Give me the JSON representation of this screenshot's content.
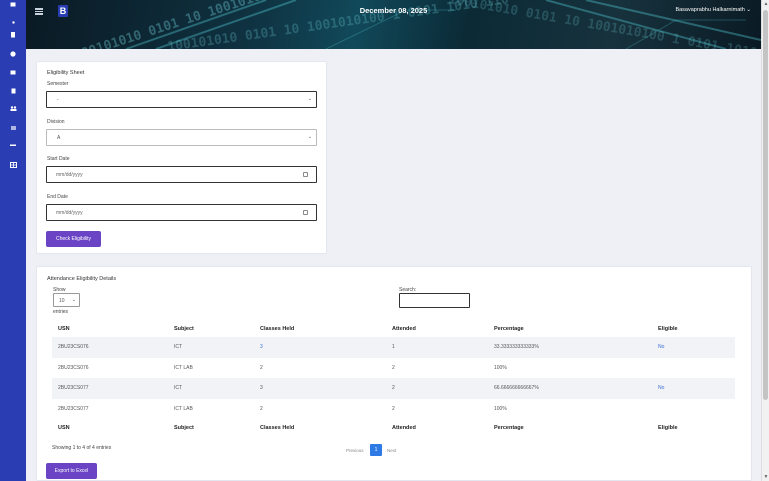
{
  "header": {
    "date": "December 08, 2025",
    "user_name": "Basavaprabhu Halkarnimath",
    "logo_text": "B",
    "banner_text": "100101010 0101 10 1001010100 1 0101 1010 110",
    "colors": {
      "sidebar": "#2a3db3",
      "accent": "#6a44c4",
      "link": "#3a6fd8",
      "page_active": "#2f7be6"
    }
  },
  "sidebar": {
    "icons": [
      "home-icon",
      "dot-icon",
      "clipboard-icon",
      "globe-icon",
      "mail-icon",
      "document-icon",
      "users-icon",
      "exchange-icon",
      "minus-icon",
      "table-icon"
    ]
  },
  "eligibility_form": {
    "title": "Eligibility Sheet",
    "semester_label": "Semester",
    "semester_value": "-",
    "division_label": "Division",
    "division_value": "A",
    "start_date_label": "Start Date",
    "start_date_placeholder": "mm/dd/yyyy",
    "end_date_label": "End Date",
    "end_date_placeholder": "mm/dd/yyyy",
    "check_button": "Check Eligibility"
  },
  "details": {
    "title": "Attendance Eligibility Details",
    "show_label": "Show",
    "entries_value": "10",
    "entries_label": "entries",
    "search_label": "Search:",
    "columns": [
      "USN",
      "Subject",
      "Classes Held",
      "Attended",
      "Percentage",
      "Eligible"
    ],
    "rows": [
      [
        "2BU23CS076",
        "ICT",
        "3",
        "1",
        "33.333333333333%",
        "No"
      ],
      [
        "2BU23CS076",
        "ICT LAB",
        "2",
        "2",
        "100%",
        ""
      ],
      [
        "2BU23CS077",
        "ICT",
        "3",
        "2",
        "66.666666666667%",
        "No"
      ],
      [
        "2BU23CS077",
        "ICT LAB",
        "2",
        "2",
        "100%",
        ""
      ]
    ],
    "showing_text": "Showing 1 to 4 of 4 entries",
    "previous": "Previous",
    "current_page": "1",
    "next": "Next",
    "export_button": "Export to Excel"
  }
}
